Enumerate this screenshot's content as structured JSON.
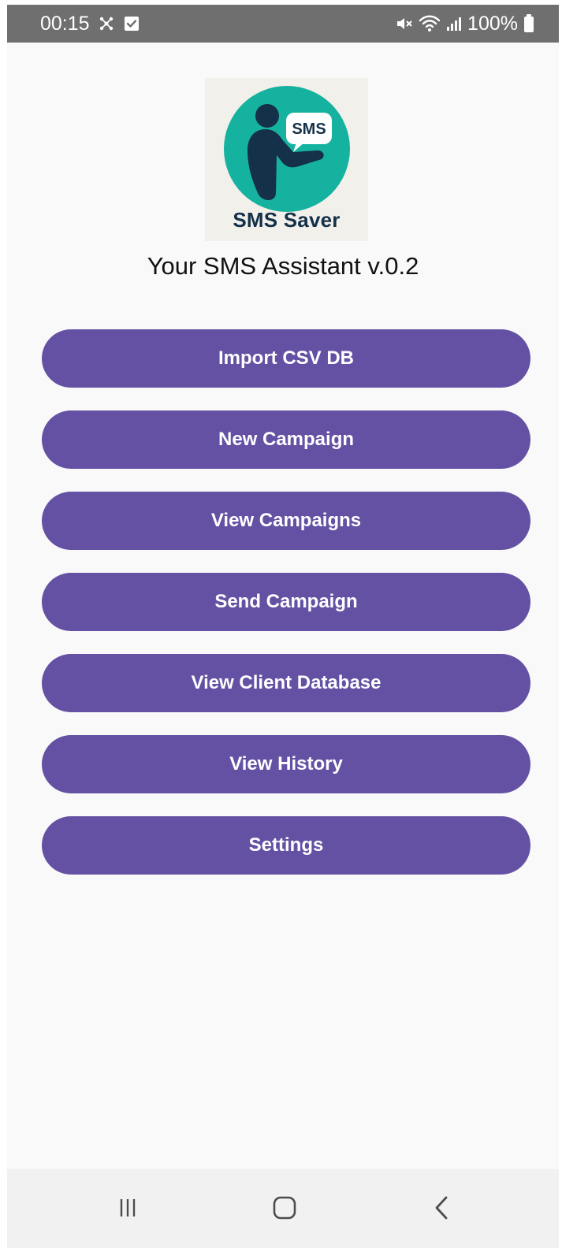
{
  "status_bar": {
    "time": "00:15",
    "battery": "100%"
  },
  "logo": {
    "bubble_text": "SMS",
    "app_name": "SMS Saver"
  },
  "header": {
    "subtitle": "Your SMS Assistant v.0.2"
  },
  "menu": {
    "items": [
      {
        "label": "Import CSV DB"
      },
      {
        "label": "New Campaign"
      },
      {
        "label": "View Campaigns"
      },
      {
        "label": "Send Campaign"
      },
      {
        "label": "View Client Database"
      },
      {
        "label": "View History"
      },
      {
        "label": "Settings"
      }
    ]
  },
  "nav": {
    "recent_icon": "recent-apps-icon",
    "home_icon": "home-icon",
    "back_icon": "back-icon"
  },
  "colors": {
    "status_bar": "#6f6f6f",
    "background": "#f9f9f9",
    "button": "#6451a3",
    "logo_teal": "#16b2a0",
    "logo_navy": "#143149"
  }
}
